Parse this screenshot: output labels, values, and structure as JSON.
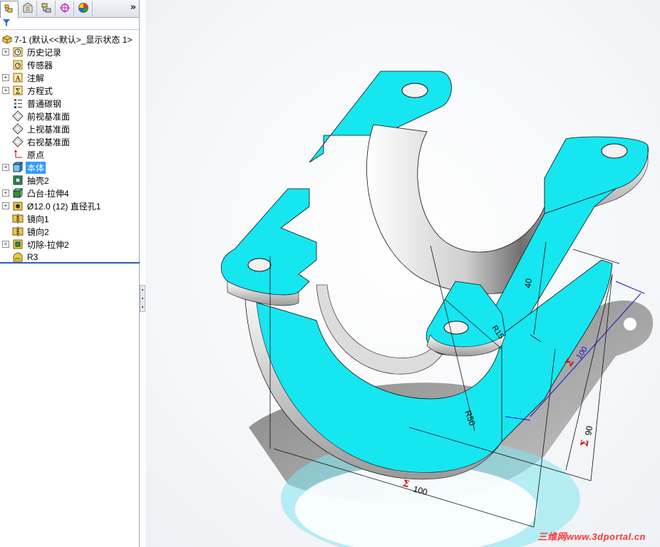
{
  "panel": {
    "tabs": [
      {
        "name": "feature-manager-tab",
        "icon": "feature-tree-icon"
      },
      {
        "name": "property-manager-tab",
        "icon": "property-icon"
      },
      {
        "name": "configuration-manager-tab",
        "icon": "configuration-icon"
      },
      {
        "name": "dimxpert-tab",
        "icon": "dimxpert-icon"
      },
      {
        "name": "display-manager-tab",
        "icon": "display-icon"
      }
    ],
    "more_label": "»",
    "root_label": "7-1  (默认<<默认>_显示状态 1>",
    "items": [
      {
        "label": "历史记录",
        "expander": "+",
        "icon": "history-icon"
      },
      {
        "label": "传感器",
        "expander": "",
        "icon": "sensor-icon"
      },
      {
        "label": "注解",
        "expander": "+",
        "icon": "annotation-icon"
      },
      {
        "label": "方程式",
        "expander": "+",
        "icon": "equation-icon"
      },
      {
        "label": "普通碳钢",
        "expander": "",
        "icon": "material-icon"
      },
      {
        "label": "前视基准面",
        "expander": "",
        "icon": "plane-icon"
      },
      {
        "label": "上视基准面",
        "expander": "",
        "icon": "plane-icon"
      },
      {
        "label": "右视基准面",
        "expander": "",
        "icon": "plane-icon"
      },
      {
        "label": "原点",
        "expander": "",
        "icon": "origin-icon"
      },
      {
        "label": "本体",
        "expander": "+",
        "icon": "extrude-icon",
        "selected": true
      },
      {
        "label": "抽壳2",
        "expander": "",
        "icon": "shell-icon"
      },
      {
        "label": "凸台-拉伸4",
        "expander": "+",
        "icon": "boss-extrude-icon"
      },
      {
        "label": "Ø12.0 (12) 直径孔1",
        "expander": "+",
        "icon": "hole-icon"
      },
      {
        "label": "镜向1",
        "expander": "",
        "icon": "mirror-icon"
      },
      {
        "label": "镜向2",
        "expander": "",
        "icon": "mirror-icon"
      },
      {
        "label": "切除-拉伸2",
        "expander": "+",
        "icon": "cut-extrude-icon"
      },
      {
        "label": "R3",
        "expander": "",
        "icon": "fillet-icon"
      }
    ]
  },
  "model": {
    "face_color": "#16e6f0",
    "dimensions": {
      "r50": "R50",
      "r15": "R15",
      "d40": "40",
      "d100_blue": "100",
      "d90": "90",
      "d100_bottom": "100"
    },
    "sigma_mark": "Σ"
  },
  "watermark": "三维网www.3dportal.cn"
}
